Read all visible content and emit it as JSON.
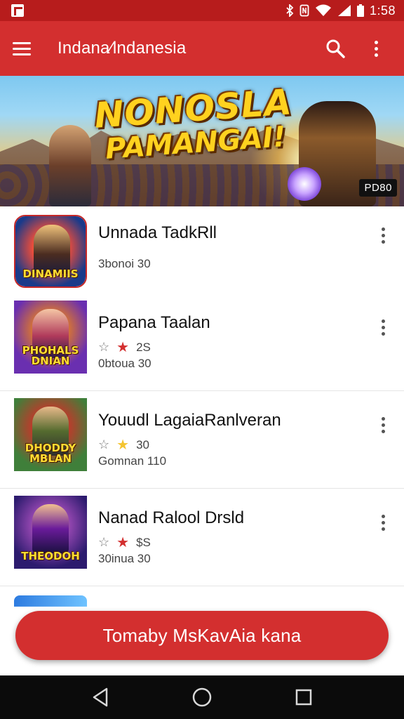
{
  "status_bar": {
    "time": "1:58",
    "icons": [
      "notification-icon",
      "bluetooth-icon",
      "nfc-icon",
      "wifi-icon",
      "signal-icon",
      "battery-icon"
    ]
  },
  "app_bar": {
    "title": "Indana∕lndanesia",
    "actions": [
      "search-icon",
      "more-vert-icon"
    ]
  },
  "banner": {
    "title_line1": "NONOSLA",
    "title_line2": "PAMANGAI!",
    "badge": "PD80"
  },
  "games": [
    {
      "title": "Unnada TadkRll",
      "subtitle": "3bonoi 30",
      "rating": null,
      "thumb_label": "DINAMIIS",
      "thumb_colors": [
        "#1a3a8a",
        "#c0392b",
        "#f1c40f"
      ]
    },
    {
      "title": "Papana Taalan",
      "rating": {
        "star_color": "#d32f2f",
        "value": "2S"
      },
      "subtitle": "0btoua 30",
      "thumb_label": "PHOHALS DNIAN",
      "thumb_colors": [
        "#6a2fb0",
        "#e67e22",
        "#f4d03f"
      ]
    },
    {
      "title": "Youudl LagaiaRanlveran",
      "rating": {
        "star_color": "#f4c430",
        "value": "30"
      },
      "subtitle": "Gomnan 110",
      "thumb_label": "DHODDY MBLAN",
      "thumb_colors": [
        "#3f7f3a",
        "#c0392b",
        "#f5b041"
      ]
    },
    {
      "title": "Nanad Ralool Drsld",
      "rating": {
        "star_color": "#d32f2f",
        "value": "$S"
      },
      "subtitle": "30inua 30",
      "thumb_label": "THEODOH",
      "thumb_colors": [
        "#2c1b6e",
        "#8e44ad",
        "#f39c12"
      ]
    }
  ],
  "cta": {
    "label": "Tomaby MsKavAia kana"
  },
  "nav": [
    "back-icon",
    "home-icon",
    "recents-icon"
  ]
}
